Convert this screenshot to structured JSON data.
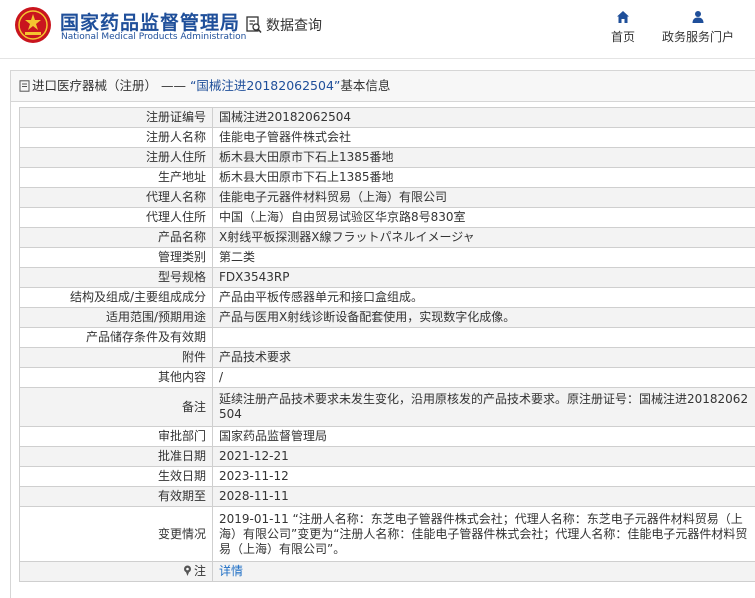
{
  "header": {
    "site_title_cn": "国家药品监督管理局",
    "site_title_en": "National Medical Products Administration",
    "query_label": "数据查询",
    "nav": {
      "home_label": "首页",
      "service_label": "政务服务门户"
    },
    "brand_color": "#1f4f9a"
  },
  "panel": {
    "title_prefix": "进口医疗器械（注册） —— ",
    "title_highlight": "“国械注进20182062504”",
    "title_suffix": "基本信息"
  },
  "rows": [
    {
      "label": "注册证编号",
      "value": "国械注进20182062504"
    },
    {
      "label": "注册人名称",
      "value": "佳能电子管器件株式会社"
    },
    {
      "label": "注册人住所",
      "value": "栃木县大田原市下石上1385番地"
    },
    {
      "label": "生产地址",
      "value": "栃木县大田原市下石上1385番地"
    },
    {
      "label": "代理人名称",
      "value": "佳能电子元器件材料贸易（上海）有限公司"
    },
    {
      "label": "代理人住所",
      "value": "中国（上海）自由贸易试验区华京路8号830室"
    },
    {
      "label": "产品名称",
      "value": "X射线平板探测器X線フラットパネルイメージャ"
    },
    {
      "label": "管理类别",
      "value": "第二类"
    },
    {
      "label": "型号规格",
      "value": "FDX3543RP"
    },
    {
      "label": "结构及组成/主要组成成分",
      "value": "产品由平板传感器单元和接口盒组成。"
    },
    {
      "label": "适用范围/预期用途",
      "value": "产品与医用X射线诊断设备配套使用，实现数字化成像。"
    },
    {
      "label": "产品储存条件及有效期",
      "value": ""
    },
    {
      "label": "附件",
      "value": "产品技术要求"
    },
    {
      "label": "其他内容",
      "value": "/"
    },
    {
      "label": "备注",
      "value": "延续注册产品技术要求未发生变化，沿用原核发的产品技术要求。原注册证号：国械注进20182062504"
    },
    {
      "label": "审批部门",
      "value": "国家药品监督管理局"
    },
    {
      "label": "批准日期",
      "value": "2021-12-21"
    },
    {
      "label": "生效日期",
      "value": "2023-11-12"
    },
    {
      "label": "有效期至",
      "value": "2028-11-11"
    },
    {
      "label": "变更情况",
      "value": "2019-01-11 “注册人名称：东芝电子管器件株式会社；代理人名称：东芝电子元器件材料贸易（上海）有限公司”变更为“注册人名称：佳能电子管器件株式会社；代理人名称：佳能电子元器件材料贸易（上海）有限公司”。"
    }
  ],
  "note_row": {
    "label": "注",
    "link_text": "详情"
  }
}
